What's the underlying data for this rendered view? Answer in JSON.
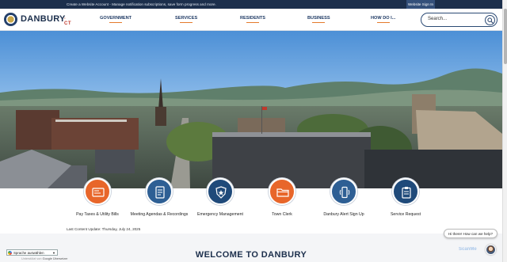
{
  "topbar": {
    "message": "Create a Website Account - Manage notification subscriptions, save form progress and more.",
    "signin_label": "Website Sign In"
  },
  "header": {
    "brand": "DANBURY",
    "brand_state": "· CT",
    "nav": [
      "GOVERNMENT",
      "SERVICES",
      "RESIDENTS",
      "BUSINESS",
      "HOW DO I..."
    ],
    "search_placeholder": "Search..."
  },
  "quick_links": [
    {
      "label": "Pay Taxes & Utility Bills",
      "icon": "bill-icon",
      "color": "#e8662a"
    },
    {
      "label": "Meeting Agendas & Recordings",
      "icon": "document-icon",
      "color": "#2e5f94"
    },
    {
      "label": "Emergency Management",
      "icon": "shield-star-icon",
      "color": "#1f4a7a"
    },
    {
      "label": "Town Clerk",
      "icon": "folder-icon",
      "color": "#e8662a"
    },
    {
      "label": "Danbury Alert Sign Up",
      "icon": "phone-alert-icon",
      "color": "#2e5f94"
    },
    {
      "label": "Service Request",
      "icon": "clipboard-icon",
      "color": "#1f4a7a"
    }
  ],
  "last_update": "Last Content Update: Thursday, July 24, 2025",
  "welcome_title": "WELCOME TO DANBURY",
  "translate": {
    "select_label": "Sprache auswählen",
    "powered_prefix": "Unterstützt von",
    "powered_by": "Google Übersetzer"
  },
  "chat": {
    "bubble_text": "Hi there! How can we help?",
    "watermark": "ScanMe"
  },
  "colors": {
    "navy": "#1c2f4c",
    "accent_orange": "#e57a2c",
    "topbar": "#1c2f4c"
  }
}
